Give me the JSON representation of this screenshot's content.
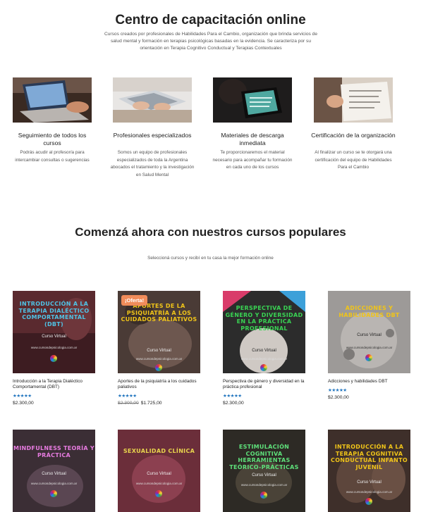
{
  "header": {
    "title": "Centro de capacitación online",
    "intro": "Cursos creados por profesionales de Habilidades Para el Cambio, organización que brinda servicios de salud mental y formación en terapias psicológicas basadas en la evidencia. Se caracteriza por su orientación en Terapia Cognitivo Conductual y Terapias Contextuales"
  },
  "features": [
    {
      "title": "Seguimiento de todos los cursos",
      "desc": "Podrás acudir al profesor/a para intercambiar consultas o sugerencias"
    },
    {
      "title": "Profesionales especializados",
      "desc": "Somos un equipo de profesionales especializados de toda la Argentina abocados el tratamiento y la investigación en Salud Mental"
    },
    {
      "title": "Materiales de descarga inmediata",
      "desc": "Te proporcionaremos el material necesario para acompañar tu formación en cada uno de los cursos"
    },
    {
      "title": "Certificación de la organización",
      "desc": "Al finalizar un curso se te otorgará una certificación del equipo de Habilidades Para el Cambio"
    }
  ],
  "popular": {
    "title": "Comenzá ahora con nuestros cursos populares",
    "subtitle": "Seleccioná cursos y recibí en tu casa la mejor formación online"
  },
  "common": {
    "course_label": "Curso Virtual",
    "url": "www.cursosdepsicologia.com.ar",
    "sale_badge": "¡Oferta!",
    "stars": "★★★★★"
  },
  "products": [
    {
      "thumb_title": "Introducción a la terapia dialéctico comportamental (DBT)",
      "name": "Introducción a la Terapia Dialéctico Comportamental (DBT)",
      "price": "$2.300,00",
      "old_price": "",
      "title_color": "#4fc3e6"
    },
    {
      "thumb_title": "Aportes de la psiquiatría a los cuidados paliativos",
      "name": "Aportes de la psiquiatría a los cuidados paliativos",
      "price": "$1.725,00",
      "old_price": "$2.300,00",
      "title_color": "#f0c419"
    },
    {
      "thumb_title": "Perspectiva de género y diversidad en la práctica profesional",
      "name": "Perspectiva de género y diversidad en la práctica profesional",
      "price": "$2.300,00",
      "old_price": "",
      "title_color": "#39d353"
    },
    {
      "thumb_title": "Adicciones y habilidades DBT",
      "name": "Adicciones y habilidades DBT",
      "price": "$2.300,00",
      "old_price": "",
      "title_color": "#f0c419"
    },
    {
      "thumb_title": "Mindfulness teoría y práctica",
      "title_color": "#e77be0"
    },
    {
      "thumb_title": "Sexualidad clínica",
      "title_color": "#e8d44d"
    },
    {
      "thumb_title": "Estimulación cognitiva herramientas teórico-prácticas",
      "title_color": "#5ee07a"
    },
    {
      "thumb_title": "Introducción a la terapia cognitiva conductual infanto juvenil",
      "title_color": "#f0c419"
    }
  ]
}
